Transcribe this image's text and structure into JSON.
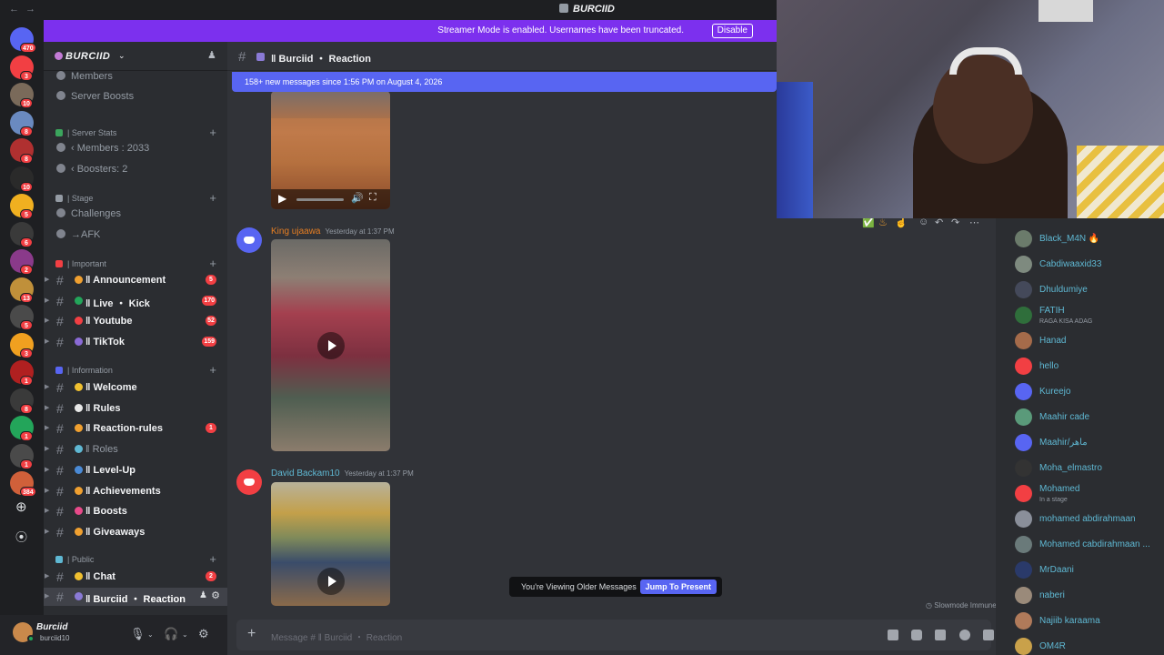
{
  "app": {
    "title": "BURCIID"
  },
  "banner": {
    "text": "Streamer Mode is enabled. Usernames have been truncated.",
    "button": "Disable"
  },
  "rail": {
    "badges": [
      "470",
      "3",
      "10",
      "8",
      "8",
      "10",
      "5",
      "6",
      "2",
      "13",
      "5",
      "3",
      "1",
      "8",
      "1",
      "1",
      "384"
    ]
  },
  "server": {
    "name": "BURCIID"
  },
  "sidebar": {
    "top_items": [
      "Members",
      "Server Boosts"
    ],
    "cat_stats": "| Server Stats",
    "stats": [
      "‹ Members : 2033",
      "‹ Boosters: 2"
    ],
    "cat_stage": "| Stage",
    "challenges": "Challenges",
    "afk": "→AFK",
    "cat_important": "| Important",
    "important": [
      {
        "label": "‖ Announcement",
        "badge": "5"
      },
      {
        "label": "‖ Live ・ Kick",
        "badge": "170"
      },
      {
        "label": "‖ Youtube",
        "badge": "52"
      },
      {
        "label": "‖ TikTok",
        "badge": "159"
      }
    ],
    "cat_info": "| Information",
    "info": [
      {
        "label": "‖ Welcome",
        "badge": ""
      },
      {
        "label": "‖ Rules",
        "badge": ""
      },
      {
        "label": "‖ Reaction-rules",
        "badge": "1"
      },
      {
        "label": "‖ Roles",
        "badge": ""
      },
      {
        "label": "‖ Level-Up",
        "badge": ""
      },
      {
        "label": "‖ Achievements",
        "badge": ""
      },
      {
        "label": "‖ Boosts",
        "badge": ""
      },
      {
        "label": "‖ Giveaways",
        "badge": ""
      }
    ],
    "cat_public": "| Public",
    "public": [
      {
        "label": "‖ Chat",
        "badge": "2"
      },
      {
        "label": "‖ Burciid ・ Reaction",
        "badge": ""
      }
    ]
  },
  "user": {
    "name": "Burciid",
    "tag": "burciid10"
  },
  "channel": {
    "title": "‖ Burciid ・ Reaction"
  },
  "new_messages": "158+ new messages since 1:56 PM on August 4, 2026",
  "messages": [
    {
      "author": "King ujaawa",
      "time": "Yesterday at 1:37 PM",
      "color": "#e67e22"
    },
    {
      "author": "David Backam10",
      "time": "Yesterday at 1:37 PM",
      "color": "#5fb8d3"
    }
  ],
  "older": {
    "text": "You're Viewing Older Messages",
    "button": "Jump To Present"
  },
  "slowmode": "Slowmode Immune",
  "composer": {
    "placeholder": "Message # ‖ Burciid ・ Reaction"
  },
  "members": [
    {
      "name": "Black_M4N 🔥",
      "sub": "",
      "color": "#6b7b6b"
    },
    {
      "name": "Cabdiwaaxid33",
      "sub": "",
      "color": "#7e8a7f"
    },
    {
      "name": "Dhuldumiye",
      "sub": "",
      "color": "#44495a"
    },
    {
      "name": "FATIH",
      "sub": "RAGA KISA ADAG",
      "color": "#2f6e3b"
    },
    {
      "name": "Hanad",
      "sub": "",
      "color": "#a56b4a"
    },
    {
      "name": "hello",
      "sub": "",
      "color": "#f23f43"
    },
    {
      "name": "Kureejo",
      "sub": "",
      "color": "#5865f2"
    },
    {
      "name": "Maahir cade",
      "sub": "",
      "color": "#5a9a7a"
    },
    {
      "name": "Maahir/ماهر",
      "sub": "",
      "color": "#5865f2"
    },
    {
      "name": "Moha_elmastro",
      "sub": "",
      "color": "#333333"
    },
    {
      "name": "Mohamed",
      "sub": "In a stage",
      "color": "#f23f43"
    },
    {
      "name": "mohamed abdirahmaan",
      "sub": "",
      "color": "#8a8f9a"
    },
    {
      "name": "Mohamed cabdirahmaan ...",
      "sub": "",
      "color": "#6a7a7a"
    },
    {
      "name": "MrDaani",
      "sub": "",
      "color": "#2a3a6a"
    },
    {
      "name": "naberi",
      "sub": "",
      "color": "#9a8a7a"
    },
    {
      "name": "Najiib karaama",
      "sub": "",
      "color": "#b07a5a"
    },
    {
      "name": "OM4R",
      "sub": "",
      "color": "#c9a14a"
    }
  ]
}
